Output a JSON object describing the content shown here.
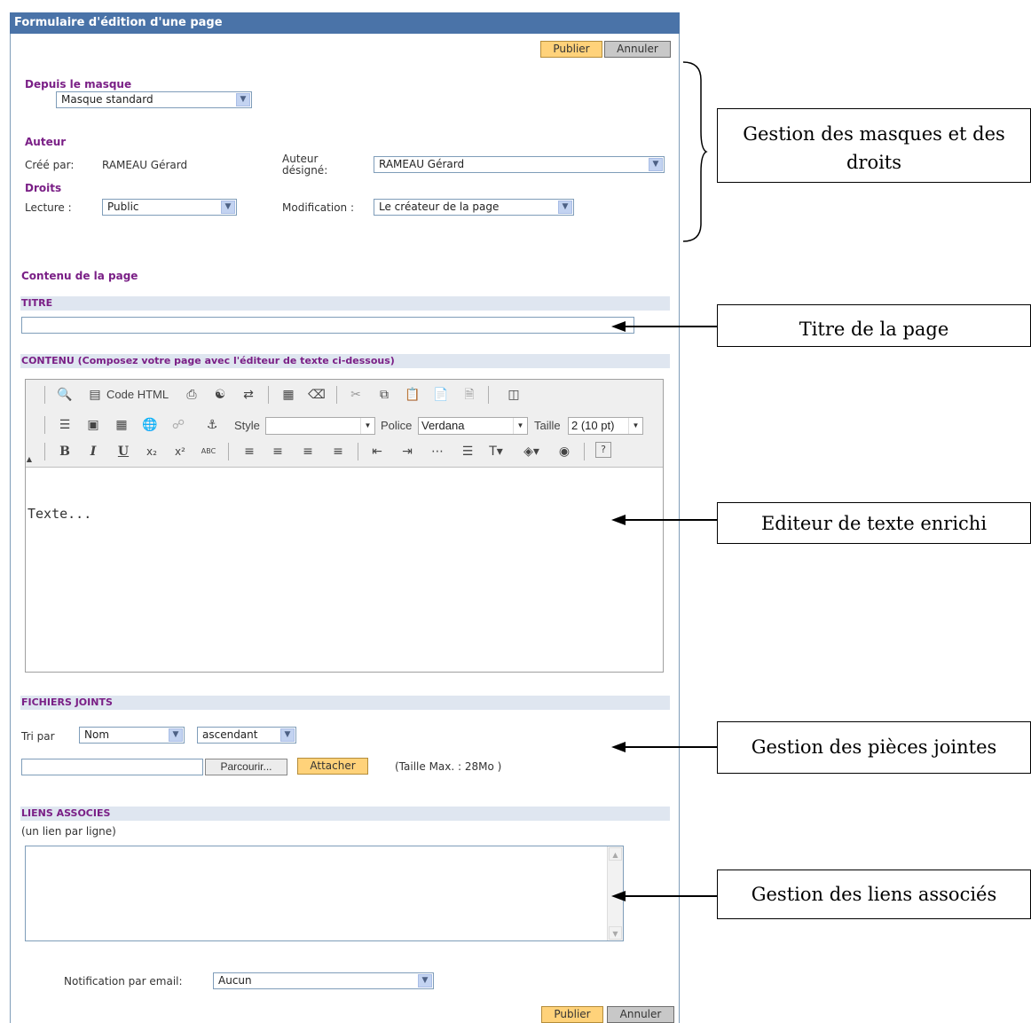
{
  "panel": {
    "title": "Formulaire d'édition d'une page"
  },
  "actions": {
    "publish_label": "Publier",
    "cancel_label": "Annuler"
  },
  "template": {
    "heading": "Depuis le masque",
    "selected": "Masque standard"
  },
  "author": {
    "heading": "Auteur",
    "created_by_label": "Créé par:",
    "created_by_value": "RAMEAU Gérard",
    "designated_label_line1": "Auteur",
    "designated_label_line2": "désigné:",
    "designated_value": "RAMEAU Gérard"
  },
  "rights": {
    "heading": "Droits",
    "read_label": "Lecture :",
    "read_value": "Public",
    "modify_label": "Modification :",
    "modify_value": "Le créateur de la page"
  },
  "content_heading": "Contenu de la page",
  "title_section": {
    "label": "TITRE",
    "value": ""
  },
  "content_section": {
    "label": "CONTENU (Composez votre page avec l'éditeur de texte ci-dessous)"
  },
  "editor": {
    "code_html_label": "Code HTML",
    "style_label": "Style",
    "style_value": "",
    "font_label": "Police",
    "font_value": "Verdana",
    "size_label": "Taille",
    "size_value": "2 (10 pt)",
    "text": "Texte...",
    "bold_glyph": "B",
    "italic_glyph": "I",
    "underline_glyph": "U",
    "spell_glyph": "ABC"
  },
  "attachments": {
    "label": "FICHIERS JOINTS",
    "sort_label": "Tri par",
    "sort_field": "Nom",
    "sort_order": "ascendant",
    "file_value": "",
    "browse_label": "Parcourir...",
    "attach_label": "Attacher",
    "max_size": "(Taille Max. : 28Mo )"
  },
  "links": {
    "label": "LIENS ASSOCIES",
    "hint": "(un lien par ligne)",
    "value": ""
  },
  "notification": {
    "label": "Notification par email:",
    "value": "Aucun"
  },
  "annotations": {
    "masks_rights": "Gestion des masques et des droits",
    "page_title": "Titre de la page",
    "rich_editor": "Editeur de texte enrichi",
    "attachments": "Gestion des pièces jointes",
    "links": "Gestion des liens associés"
  }
}
